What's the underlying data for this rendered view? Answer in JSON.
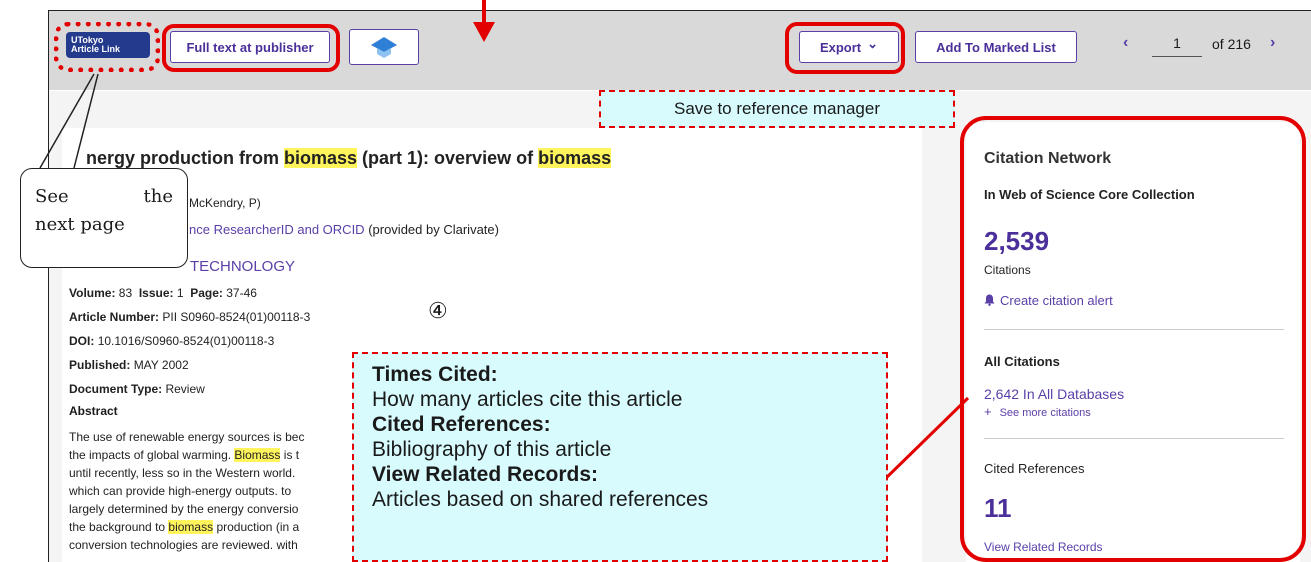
{
  "toolbar": {
    "utokyo_line1": "UTokyo",
    "utokyo_line2": "Article Link",
    "full_text_label": "Full text at publisher",
    "export_label": "Export",
    "export_chevron": "⌄",
    "add_to_marked_label": "Add To Marked List",
    "prev_arrow": "‹",
    "next_arrow": "›",
    "page_current": "1",
    "page_total": "of 216"
  },
  "article": {
    "title_pre": "nergy production from ",
    "title_hl1": "biomass",
    "title_mid": " (part 1): overview of ",
    "title_hl2": "biomass",
    "author_fragment": "McKendry, P)",
    "researcher_link": "nce ResearcherID and ORCID",
    "researcher_suffix": " (provided by Clarivate)",
    "journal": "TECHNOLOGY",
    "volume_label": "Volume:",
    "volume": "83",
    "issue_label": "Issue:",
    "issue": "1",
    "page_label": "Page:",
    "pages": "37-46",
    "article_number_label": "Article Number:",
    "article_number": "PII S0960-8524(01)00118-3",
    "doi_label": "DOI:",
    "doi": "10.1016/S0960-8524(01)00118-3",
    "published_label": "Published:",
    "published": "MAY 2002",
    "doctype_label": "Document Type:",
    "doctype": "Review",
    "abstract_heading": "Abstract",
    "abstract_lines": [
      "The use of renewable energy sources is bec",
      "the impacts of global warming.",
      "until recently, less so in the Western world.",
      "which can provide high-energy outputs. to",
      "largely determined by the energy conversio",
      "the background to",
      "conversion technologies are reviewed. with"
    ],
    "abstract_hl_line2": "Biomass",
    "abstract_tail_line2": " is t",
    "abstract_hl_line6": "biomass",
    "abstract_tail_line6": " production (in a"
  },
  "callouts": {
    "save": "Save to reference manager",
    "circled_number": "④",
    "bubble_word1": "See",
    "bubble_word2": "the",
    "bubble_line2": "next page",
    "times_cited_head": "Times Cited:",
    "times_cited_body": "How many articles cite this article",
    "cited_refs_head": "Cited References:",
    "cited_refs_body": "Bibliography of this article",
    "related_head": "View Related Records:",
    "related_body": "Articles based on shared references"
  },
  "citation_network": {
    "title": "Citation Network",
    "subtitle": "In Web of Science Core Collection",
    "citations_count": "2,539",
    "citations_label": "Citations",
    "alert_link": "Create citation alert",
    "all_citations_title": "All Citations",
    "all_databases_link": "2,642 In All Databases",
    "see_more_link": "See more citations",
    "cited_references_title": "Cited References",
    "cited_references_count": "11",
    "related_records_link": "View Related Records"
  },
  "colors": {
    "accent": "#5b3fa8",
    "highlight_ring": "#e30000",
    "callout_bg": "#d8fbfd",
    "search_highlight": "#fff45c"
  },
  "icons": [
    "chevron-down-icon",
    "bell-icon",
    "plus-icon",
    "chevron-left-icon",
    "chevron-right-icon",
    "graduation-cap-icon"
  ]
}
